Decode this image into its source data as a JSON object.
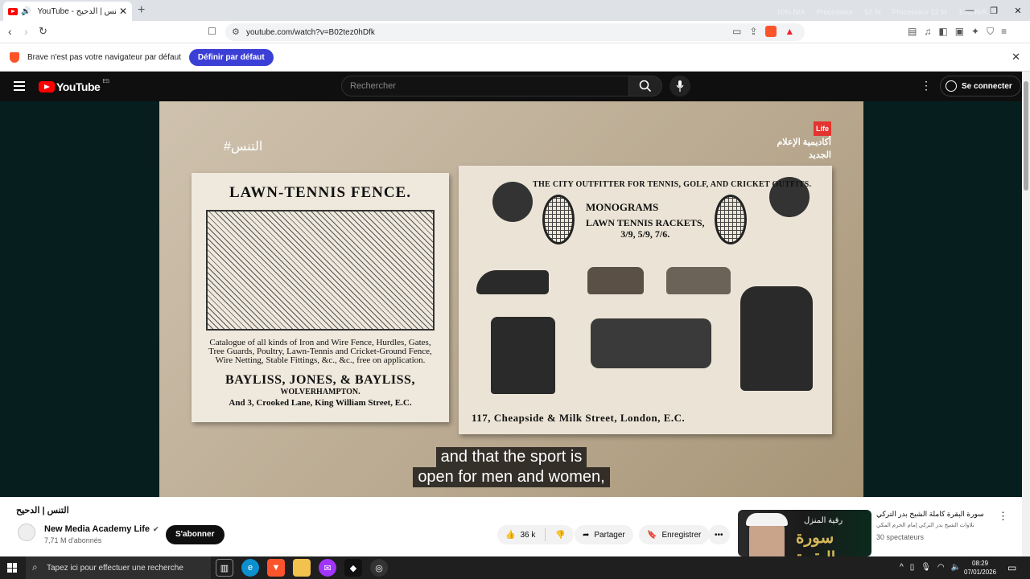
{
  "browser": {
    "tab_title": "YouTube - التنس | الدحيح",
    "url": "youtube.com/watch?v=B02tez0hDfk",
    "sysmon": [
      "10% N/A",
      "Processeur",
      "52 %",
      "Processeur 12 %",
      "1 AL N/A"
    ],
    "infobar": {
      "message": "Brave n'est pas votre navigateur par défaut",
      "button": "Définir par défaut"
    }
  },
  "youtube": {
    "logo_text": "YouTube",
    "region": "ES",
    "search_placeholder": "Rechercher",
    "signin": "Se connecter"
  },
  "video": {
    "hashtag": "#التنس",
    "channel_logo_tag": "Life",
    "channel_logo_text": "أكاديمية الإعلام الجديد",
    "poster_left": {
      "headline": "LAWN-TENNIS FENCE.",
      "body": "Catalogue of all kinds of Iron and Wire Fence, Hurdles, Gates, Tree Guards, Poultry, Lawn-Tennis and Cricket-Ground Fence, Wire Netting, Stable Fittings, &c., &c., free on application.",
      "company": "BAYLISS, JONES, & BAYLISS,",
      "city": "WOLVERHAMPTON.",
      "address": "And 3, Crooked Lane, King William Street, E.C."
    },
    "poster_right": {
      "headline": "THE CITY OUTFITTER FOR TENNIS, GOLF, AND CRICKET OUTFITS.",
      "monograms": "MONOGRAMS",
      "rackets": "LAWN TENNIS RACKETS,",
      "prices": "3/9, 5/9, 7/6.",
      "footer": "117, Cheapside & Milk Street, London, E.C."
    },
    "subtitle_lines": [
      "and that the sport is",
      "open for men and women,"
    ]
  },
  "below_video": {
    "title": "التنس | الدحيح",
    "channel_name": "New Media Academy Life",
    "subscribers": "7,71 M d'abonnés",
    "subscribe": "S'abonner",
    "likes": "36 k",
    "share": "Partager",
    "save": "Enregistrer"
  },
  "recommendation": {
    "title": "سورة البقرة كاملة  الشيخ بدر التركي",
    "channel": "تلاوات الشيخ بدر التركي إمام الحرم المكي",
    "views": "30 spectateurs",
    "thumb_text1": "رقية المنزل",
    "thumb_text2": "سورة البقرة"
  },
  "taskbar": {
    "search_placeholder": "Tapez ici pour effectuer une recherche",
    "time": "08:29",
    "date": "07/01/2026"
  }
}
